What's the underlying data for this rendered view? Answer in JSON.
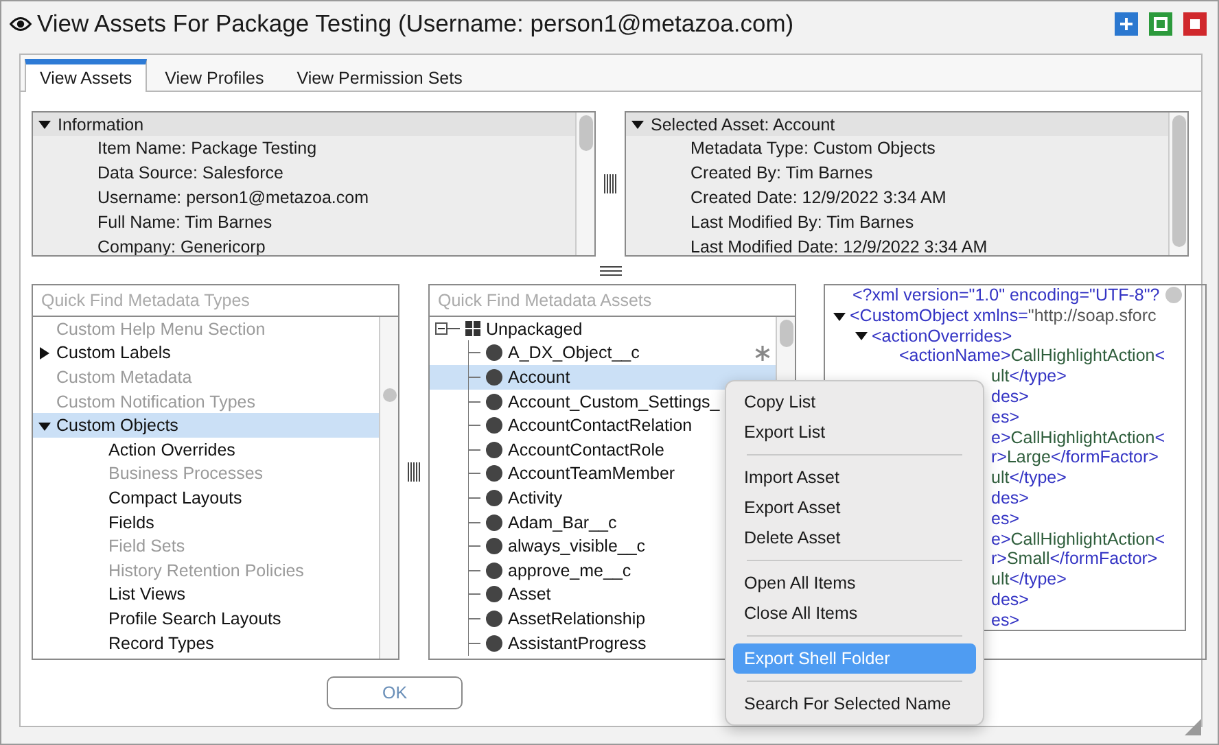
{
  "window": {
    "title": "View Assets For Package Testing (Username: person1@metazoa.com)"
  },
  "tabs": [
    {
      "label": "View Assets",
      "selected": true
    },
    {
      "label": "View Profiles",
      "selected": false
    },
    {
      "label": "View Permission Sets",
      "selected": false
    }
  ],
  "info_panels": [
    {
      "heading": "Information",
      "expanded": true,
      "lines": [
        "Item Name: Package Testing",
        "Data Source: Salesforce",
        "Username: person1@metazoa.com",
        "Full Name: Tim Barnes",
        "Company: Genericorp"
      ]
    },
    {
      "heading": "Selected Asset: Account",
      "expanded": true,
      "lines": [
        "Metadata Type: Custom Objects",
        "Created By: Tim Barnes",
        "Created Date: 12/9/2022 3:34 AM",
        "Last Modified By: Tim Barnes",
        "Last Modified Date: 12/9/2022 3:34 AM"
      ]
    }
  ],
  "types_panel": {
    "placeholder": "Quick Find Metadata Types",
    "items": [
      {
        "label": "Custom Help Menu Section",
        "disabled": true,
        "selected": false
      },
      {
        "label": "Custom Labels",
        "disabled": false,
        "selected": false,
        "expanded": false
      },
      {
        "label": "Custom Metadata",
        "disabled": true,
        "selected": false
      },
      {
        "label": "Custom Notification Types",
        "disabled": true,
        "selected": false
      },
      {
        "label": "Custom Objects",
        "disabled": false,
        "selected": true,
        "expanded": true,
        "children": [
          {
            "label": "Action Overrides",
            "disabled": false,
            "selected": false
          },
          {
            "label": "Business Processes",
            "disabled": true,
            "selected": false
          },
          {
            "label": "Compact Layouts",
            "disabled": false,
            "selected": false
          },
          {
            "label": "Fields",
            "disabled": false,
            "selected": false
          },
          {
            "label": "Field Sets",
            "disabled": true,
            "selected": false
          },
          {
            "label": "History Retention Policies",
            "disabled": true,
            "selected": false
          },
          {
            "label": "List Views",
            "disabled": false,
            "selected": false
          },
          {
            "label": "Profile Search Layouts",
            "disabled": false,
            "selected": false
          },
          {
            "label": "Record Types",
            "disabled": false,
            "selected": false
          }
        ]
      }
    ]
  },
  "assets_panel": {
    "placeholder": "Quick Find Metadata Assets",
    "root": {
      "label": "Unpackaged",
      "expanded": true,
      "children": [
        {
          "label": "A_DX_Object__c",
          "selected": false,
          "flagged": true
        },
        {
          "label": "Account",
          "selected": true,
          "flagged": false
        },
        {
          "label": "Account_Custom_Settings_",
          "selected": false,
          "flagged": false
        },
        {
          "label": "AccountContactRelation",
          "selected": false,
          "flagged": false
        },
        {
          "label": "AccountContactRole",
          "selected": false,
          "flagged": false
        },
        {
          "label": "AccountTeamMember",
          "selected": false,
          "flagged": false
        },
        {
          "label": "Activity",
          "selected": false,
          "flagged": false
        },
        {
          "label": "Adam_Bar__c",
          "selected": false,
          "flagged": false
        },
        {
          "label": "always_visible__c",
          "selected": false,
          "flagged": false
        },
        {
          "label": "approve_me__c",
          "selected": false,
          "flagged": false
        },
        {
          "label": "Asset",
          "selected": false,
          "flagged": false
        },
        {
          "label": "AssetRelationship",
          "selected": false,
          "flagged": false
        },
        {
          "label": "AssistantProgress",
          "selected": false,
          "flagged": false
        }
      ]
    }
  },
  "xml_panel": {
    "declaration": [
      {
        "kind": "tag",
        "text": "<?xml version=\"1.0\" encoding=\"UTF-8\"?"
      }
    ],
    "root": {
      "parts": [
        {
          "kind": "tag",
          "text": "<CustomObject xmlns="
        },
        {
          "kind": "value",
          "text": "\"http://soap.sforc"
        }
      ],
      "expanded": true,
      "children": [
        {
          "parts": [
            {
              "kind": "tag",
              "text": "<actionOverrides>"
            }
          ],
          "expanded": true,
          "children": [
            {
              "parts": [
                {
                  "kind": "tag",
                  "text": "<actionName>"
                },
                {
                  "kind": "text",
                  "text": "CallHighlightAction"
                },
                {
                  "kind": "tag",
                  "text": "<"
                }
              ]
            }
          ]
        }
      ]
    },
    "covered_lines": [
      [
        {
          "kind": "text",
          "text": "ult"
        },
        {
          "kind": "tag",
          "text": "</type>"
        }
      ],
      [
        {
          "kind": "tag",
          "text": "des>"
        }
      ],
      [
        {
          "kind": "tag",
          "text": "es>"
        }
      ],
      [
        {
          "kind": "tag",
          "text": "e>"
        },
        {
          "kind": "text",
          "text": "CallHighlightAction"
        },
        {
          "kind": "tag",
          "text": "<"
        }
      ],
      [
        {
          "kind": "tag",
          "text": "r>"
        },
        {
          "kind": "text",
          "text": "Large"
        },
        {
          "kind": "tag",
          "text": "</formFactor>"
        }
      ],
      [
        {
          "kind": "text",
          "text": "ult"
        },
        {
          "kind": "tag",
          "text": "</type>"
        }
      ],
      [
        {
          "kind": "tag",
          "text": "des>"
        }
      ],
      [
        {
          "kind": "tag",
          "text": "es>"
        }
      ],
      [
        {
          "kind": "tag",
          "text": "e>"
        },
        {
          "kind": "text",
          "text": "CallHighlightAction"
        },
        {
          "kind": "tag",
          "text": "<"
        }
      ],
      [
        {
          "kind": "tag",
          "text": "r>"
        },
        {
          "kind": "text",
          "text": "Small"
        },
        {
          "kind": "tag",
          "text": "</formFactor>"
        }
      ],
      [
        {
          "kind": "text",
          "text": "ult"
        },
        {
          "kind": "tag",
          "text": "</type>"
        }
      ],
      [
        {
          "kind": "tag",
          "text": "des>"
        }
      ],
      [
        {
          "kind": "tag",
          "text": "es>"
        }
      ]
    ]
  },
  "context_menu": [
    {
      "kind": "item",
      "label": "Copy List",
      "selected": false
    },
    {
      "kind": "item",
      "label": "Export List",
      "selected": false
    },
    {
      "kind": "separator"
    },
    {
      "kind": "item",
      "label": "Import Asset",
      "selected": false
    },
    {
      "kind": "item",
      "label": "Export Asset",
      "selected": false
    },
    {
      "kind": "item",
      "label": "Delete Asset",
      "selected": false
    },
    {
      "kind": "separator"
    },
    {
      "kind": "item",
      "label": "Open All Items",
      "selected": false
    },
    {
      "kind": "item",
      "label": "Close All Items",
      "selected": false
    },
    {
      "kind": "separator"
    },
    {
      "kind": "item",
      "label": "Export Shell Folder",
      "selected": true
    },
    {
      "kind": "separator"
    },
    {
      "kind": "item",
      "label": "Search For Selected Name",
      "selected": false
    }
  ],
  "buttons": [
    "OK"
  ]
}
